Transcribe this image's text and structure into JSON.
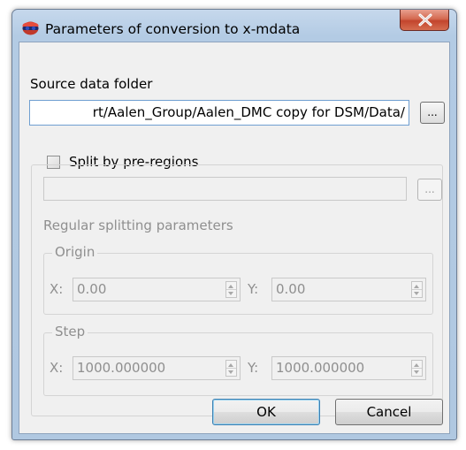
{
  "window": {
    "title": "Parameters of conversion to x-mdata",
    "close_icon": "close-x-icon"
  },
  "source": {
    "label": "Source data folder",
    "path_value": "rt/Aalen_Group/Aalen_DMC copy for DSM/Data/",
    "browse_label": "..."
  },
  "split": {
    "checkbox_label": "Split by pre-regions",
    "checked": false,
    "file_value": "",
    "browse_label": "..."
  },
  "regular": {
    "heading": "Regular splitting parameters",
    "origin": {
      "legend": "Origin",
      "x_label": "X:",
      "x_value": "0.00",
      "y_label": "Y:",
      "y_value": "0.00"
    },
    "step": {
      "legend": "Step",
      "x_label": "X:",
      "x_value": "1000.000000",
      "y_label": "Y:",
      "y_value": "1000.000000"
    }
  },
  "buttons": {
    "ok_label": "OK",
    "cancel_label": "Cancel"
  }
}
